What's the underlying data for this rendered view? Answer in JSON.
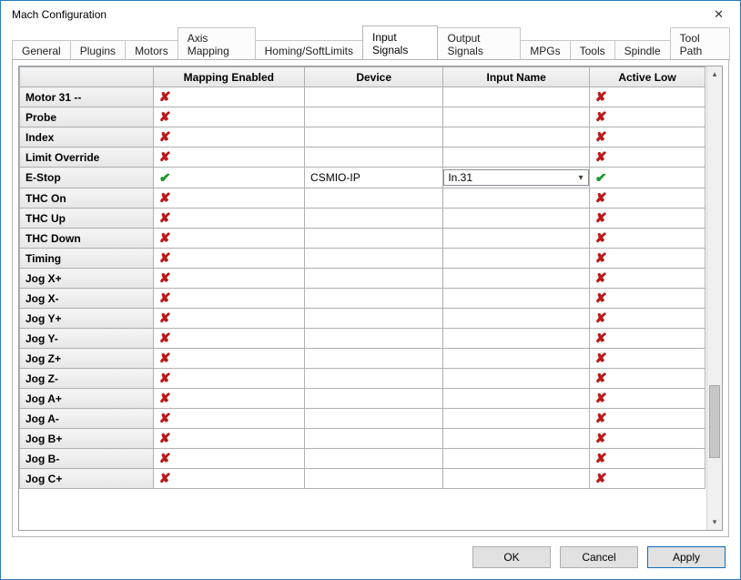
{
  "window": {
    "title": "Mach Configuration"
  },
  "tabs": [
    {
      "label": "General",
      "active": false
    },
    {
      "label": "Plugins",
      "active": false
    },
    {
      "label": "Motors",
      "active": false
    },
    {
      "label": "Axis Mapping",
      "active": false
    },
    {
      "label": "Homing/SoftLimits",
      "active": false
    },
    {
      "label": "Input Signals",
      "active": true
    },
    {
      "label": "Output Signals",
      "active": false
    },
    {
      "label": "MPGs",
      "active": false
    },
    {
      "label": "Tools",
      "active": false
    },
    {
      "label": "Spindle",
      "active": false
    },
    {
      "label": "Tool Path",
      "active": false
    }
  ],
  "columns": [
    "",
    "Mapping Enabled",
    "Device",
    "Input Name",
    "Active Low"
  ],
  "rows": [
    {
      "name": "Motor 31 --",
      "enabled": false,
      "device": "",
      "input": "",
      "activeLow": false
    },
    {
      "name": "Probe",
      "enabled": false,
      "device": "",
      "input": "",
      "activeLow": false
    },
    {
      "name": "Index",
      "enabled": false,
      "device": "",
      "input": "",
      "activeLow": false
    },
    {
      "name": "Limit Override",
      "enabled": false,
      "device": "",
      "input": "",
      "activeLow": false
    },
    {
      "name": "E-Stop",
      "enabled": true,
      "device": "CSMIO-IP",
      "input": "In.31",
      "inputEditing": true,
      "activeLow": true
    },
    {
      "name": "THC On",
      "enabled": false,
      "device": "",
      "input": "",
      "activeLow": false
    },
    {
      "name": "THC Up",
      "enabled": false,
      "device": "",
      "input": "",
      "activeLow": false
    },
    {
      "name": "THC Down",
      "enabled": false,
      "device": "",
      "input": "",
      "activeLow": false
    },
    {
      "name": "Timing",
      "enabled": false,
      "device": "",
      "input": "",
      "activeLow": false
    },
    {
      "name": "Jog X+",
      "enabled": false,
      "device": "",
      "input": "",
      "activeLow": false
    },
    {
      "name": "Jog X-",
      "enabled": false,
      "device": "",
      "input": "",
      "activeLow": false
    },
    {
      "name": "Jog Y+",
      "enabled": false,
      "device": "",
      "input": "",
      "activeLow": false
    },
    {
      "name": "Jog Y-",
      "enabled": false,
      "device": "",
      "input": "",
      "activeLow": false
    },
    {
      "name": "Jog Z+",
      "enabled": false,
      "device": "",
      "input": "",
      "activeLow": false
    },
    {
      "name": "Jog Z-",
      "enabled": false,
      "device": "",
      "input": "",
      "activeLow": false
    },
    {
      "name": "Jog A+",
      "enabled": false,
      "device": "",
      "input": "",
      "activeLow": false
    },
    {
      "name": "Jog A-",
      "enabled": false,
      "device": "",
      "input": "",
      "activeLow": false
    },
    {
      "name": "Jog B+",
      "enabled": false,
      "device": "",
      "input": "",
      "activeLow": false
    },
    {
      "name": "Jog B-",
      "enabled": false,
      "device": "",
      "input": "",
      "activeLow": false
    },
    {
      "name": "Jog C+",
      "enabled": false,
      "device": "",
      "input": "",
      "activeLow": false
    }
  ],
  "buttons": {
    "ok": "OK",
    "cancel": "Cancel",
    "apply": "Apply"
  }
}
